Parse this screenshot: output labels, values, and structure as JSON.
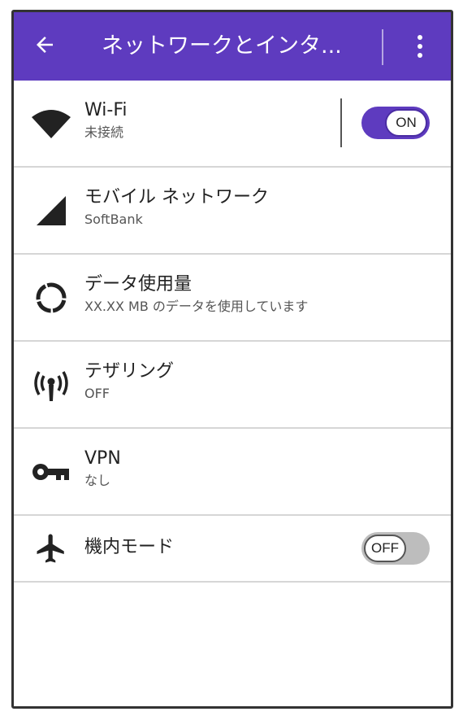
{
  "appbar": {
    "title": "ネットワークとインタ...",
    "back_icon": "arrow-back-icon",
    "more_icon": "more-vert-icon",
    "color": "#5e3bbf"
  },
  "items": [
    {
      "icon": "wifi-icon",
      "title": "Wi-Fi",
      "subtitle": "未接続",
      "toggle": "ON"
    },
    {
      "icon": "cellular-signal-icon",
      "title": "モバイル ネットワーク",
      "subtitle": "SoftBank"
    },
    {
      "icon": "data-usage-icon",
      "title": "データ使用量",
      "subtitle": "XX.XX MB のデータを使用しています"
    },
    {
      "icon": "tethering-icon",
      "title": "テザリング",
      "subtitle": "OFF"
    },
    {
      "icon": "vpn-key-icon",
      "title": "VPN",
      "subtitle": "なし"
    },
    {
      "icon": "airplane-icon",
      "title": "機内モード",
      "toggle": "OFF"
    }
  ]
}
